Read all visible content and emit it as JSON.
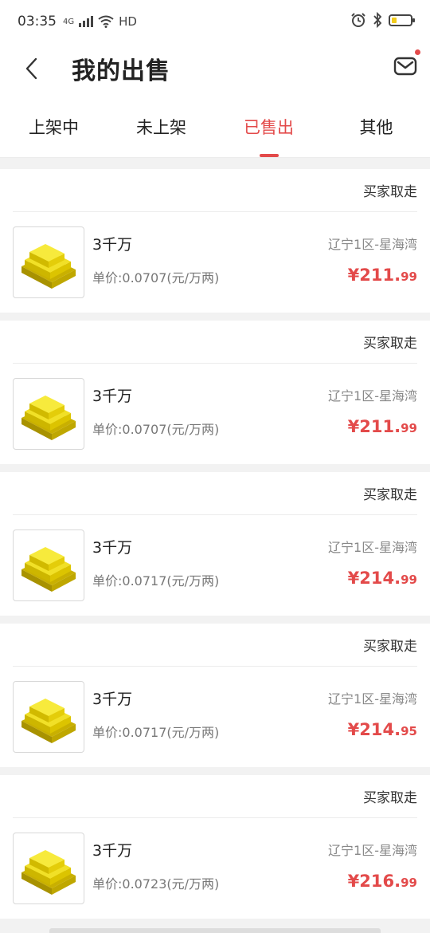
{
  "status_bar": {
    "time": "03:35",
    "network": "4G",
    "hd": "HD",
    "battery_level": 0.25
  },
  "header": {
    "title": "我的出售",
    "back_icon": "chevron-left-icon",
    "mail_icon": "mail-icon",
    "has_notification": true
  },
  "tabs": [
    {
      "label": "上架中",
      "active": false
    },
    {
      "label": "未上架",
      "active": false
    },
    {
      "label": "已售出",
      "active": true
    },
    {
      "label": "其他",
      "active": false
    }
  ],
  "orders": [
    {
      "status": "买家取走",
      "quantity": "3千万",
      "unit_price": "单价:0.0707(元/万两)",
      "server": "辽宁1区-星海湾",
      "price_symbol": "¥",
      "price_int": "211.",
      "price_dec": "99",
      "thumbnail_icon": "gold-ingot-icon"
    },
    {
      "status": "买家取走",
      "quantity": "3千万",
      "unit_price": "单价:0.0707(元/万两)",
      "server": "辽宁1区-星海湾",
      "price_symbol": "¥",
      "price_int": "211.",
      "price_dec": "99",
      "thumbnail_icon": "gold-ingot-icon"
    },
    {
      "status": "买家取走",
      "quantity": "3千万",
      "unit_price": "单价:0.0717(元/万两)",
      "server": "辽宁1区-星海湾",
      "price_symbol": "¥",
      "price_int": "214.",
      "price_dec": "99",
      "thumbnail_icon": "gold-ingot-icon"
    },
    {
      "status": "买家取走",
      "quantity": "3千万",
      "unit_price": "单价:0.0717(元/万两)",
      "server": "辽宁1区-星海湾",
      "price_symbol": "¥",
      "price_int": "214.",
      "price_dec": "95",
      "thumbnail_icon": "gold-ingot-icon"
    },
    {
      "status": "买家取走",
      "quantity": "3千万",
      "unit_price": "单价:0.0723(元/万两)",
      "server": "辽宁1区-星海湾",
      "price_symbol": "¥",
      "price_int": "216.",
      "price_dec": "99",
      "thumbnail_icon": "gold-ingot-icon"
    }
  ],
  "colors": {
    "accent": "#e34a4a",
    "gold": "#e8d21a",
    "background": "#f2f2f2"
  }
}
